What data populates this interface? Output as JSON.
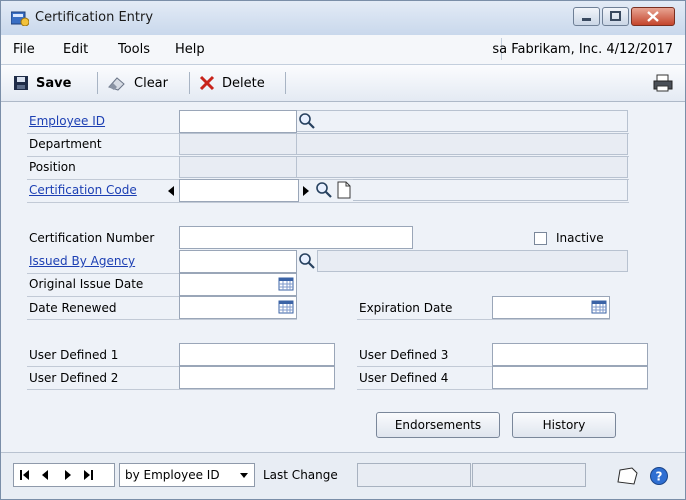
{
  "window": {
    "title": "Certification Entry"
  },
  "menu": {
    "items": [
      "File",
      "Edit",
      "Tools",
      "Help"
    ],
    "right_info": "sa  Fabrikam, Inc. 4/12/2017"
  },
  "toolbar": {
    "save": "Save",
    "clear": "Clear",
    "delete": "Delete"
  },
  "form": {
    "employee_id": "Employee ID",
    "department": "Department",
    "position": "Position",
    "certification_code": "Certification Code",
    "certification_number": "Certification Number",
    "inactive": "Inactive",
    "issued_by_agency": "Issued By Agency",
    "original_issue_date": "Original Issue Date",
    "date_renewed": "Date Renewed",
    "expiration_date": "Expiration Date",
    "user_defined_1": "User Defined 1",
    "user_defined_2": "User Defined 2",
    "user_defined_3": "User Defined 3",
    "user_defined_4": "User Defined 4"
  },
  "buttons": {
    "endorsements": "Endorsements",
    "history": "History"
  },
  "statusbar": {
    "sort_by": "by Employee ID",
    "last_change": "Last Change"
  }
}
